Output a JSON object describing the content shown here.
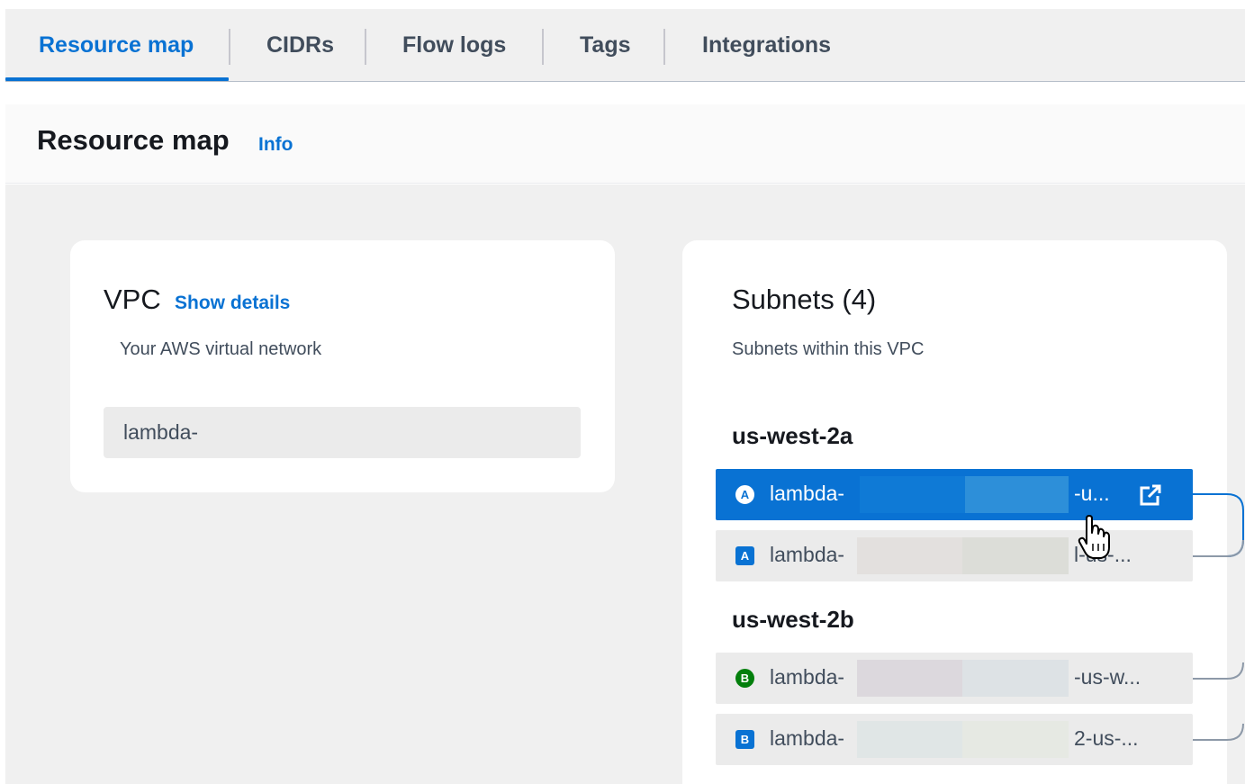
{
  "tabs": [
    {
      "label": "Resource map",
      "active": true
    },
    {
      "label": "CIDRs",
      "active": false
    },
    {
      "label": "Flow logs",
      "active": false
    },
    {
      "label": "Tags",
      "active": false
    },
    {
      "label": "Integrations",
      "active": false
    }
  ],
  "header": {
    "title": "Resource map",
    "info_link": "Info"
  },
  "vpc": {
    "title": "VPC",
    "details_link": "Show details",
    "description": "Your AWS virtual network",
    "node_label": "lambda-"
  },
  "subnets": {
    "title": "Subnets (4)",
    "description": "Subnets within this VPC",
    "zones": [
      {
        "name": "us-west-2a",
        "items": [
          {
            "badge": "A",
            "name_prefix": "lambda-",
            "name_suffix": "-u...",
            "selected": true,
            "badge_shape": "circle-outline-icon",
            "external_link": "external-link-icon"
          },
          {
            "badge": "A",
            "name_prefix": "lambda-",
            "name_suffix": "l-us-...",
            "selected": false,
            "badge_shape": "square-badge-icon",
            "badge_color": "#0972d3"
          }
        ]
      },
      {
        "name": "us-west-2b",
        "items": [
          {
            "badge": "B",
            "name_prefix": "lambda-",
            "name_suffix": "-us-w...",
            "selected": false,
            "badge_shape": "circle-badge-icon",
            "badge_color": "#037f0c"
          },
          {
            "badge": "B",
            "name_prefix": "lambda-",
            "name_suffix": "2-us-...",
            "selected": false,
            "badge_shape": "square-badge-icon",
            "badge_color": "#0972d3"
          }
        ]
      }
    ]
  },
  "colors": {
    "accent": "#0972d3",
    "selected_row": "#0972d3",
    "green_badge": "#037f0c",
    "canvas_bg": "#f0f0f0"
  }
}
